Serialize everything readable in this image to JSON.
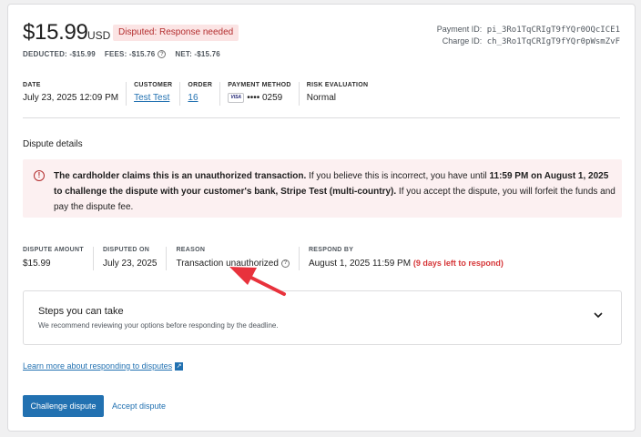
{
  "header": {
    "amount": "$15.99",
    "currency": "USD",
    "status_badge": "Disputed: Response needed",
    "deducted": "DEDUCTED: -$15.99",
    "fees": "FEES: -$15.76",
    "net": "NET: -$15.76",
    "payment_id_label": "Payment ID:",
    "payment_id": "pi_3Ro1TqCRIgT9fYQr0OQcICE1",
    "charge_id_label": "Charge ID:",
    "charge_id": "ch_3Ro1TqCRIgT9fYQr0pWsmZvF"
  },
  "meta": {
    "date_label": "DATE",
    "date_value": "July 23, 2025 12:09 PM",
    "customer_label": "CUSTOMER",
    "customer_value": "Test Test",
    "order_label": "ORDER",
    "order_value": "16",
    "payment_method_label": "PAYMENT METHOD",
    "card_brand": "VISA",
    "card_last4": "•••• 0259",
    "risk_label": "RISK EVALUATION",
    "risk_value": "Normal"
  },
  "dispute": {
    "section_title": "Dispute details",
    "alert_bold1": "The cardholder claims this is an unauthorized transaction.",
    "alert_text1": " If you believe this is incorrect, you have until ",
    "alert_bold2": "11:59 PM on August 1, 2025 to challenge the dispute with your customer's bank, Stripe Test (multi-country).",
    "alert_text2": " If you accept the dispute, you will forfeit the funds and pay the dispute fee.",
    "amount_label": "DISPUTE AMOUNT",
    "amount_value": "$15.99",
    "disputed_on_label": "DISPUTED ON",
    "disputed_on_value": "July 23, 2025",
    "reason_label": "REASON",
    "reason_value": "Transaction unauthorized",
    "respond_by_label": "RESPOND BY",
    "respond_by_value": "August 1, 2025 11:59 PM",
    "respond_by_warning": "(9 days left to respond)"
  },
  "steps": {
    "title": "Steps you can take",
    "description": "We recommend reviewing your options before responding by the deadline."
  },
  "actions": {
    "learn_more": "Learn more about responding to disputes",
    "challenge": "Challenge dispute",
    "accept": "Accept dispute"
  },
  "colors": {
    "accent": "#2271b1",
    "danger": "#d63638",
    "alert_bg": "#fcf0f1",
    "annotation_arrow": "#e8323c"
  }
}
